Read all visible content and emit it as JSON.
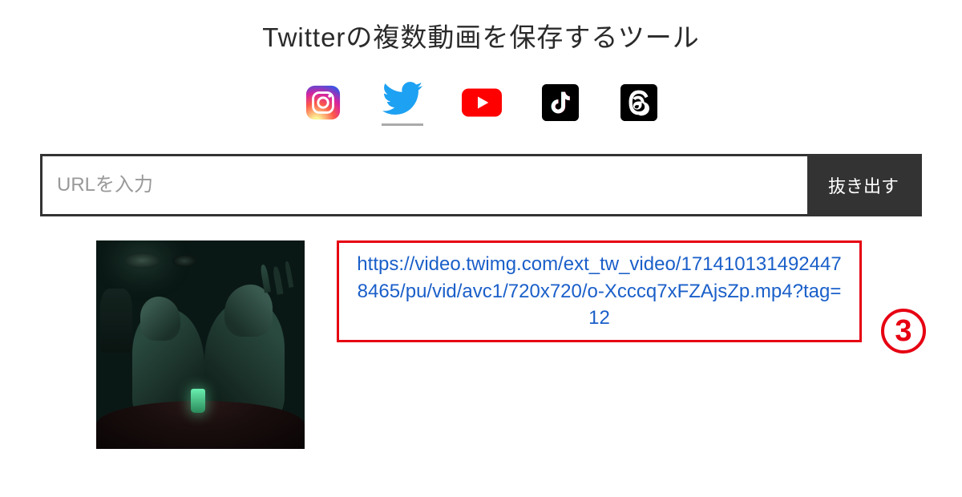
{
  "title": "Twitterの複数動画を保存するツール",
  "social": {
    "instagram": "Instagram",
    "twitter": "Twitter",
    "youtube": "YouTube",
    "tiktok": "TikTok",
    "threads": "Threads"
  },
  "input": {
    "placeholder": "URLを入力"
  },
  "button": {
    "extract": "抜き出す"
  },
  "result": {
    "url": "https://video.twimg.com/ext_tw_video/1714101314924478465/pu/vid/avc1/720x720/o-Xcccq7xFZAjsZp.mp4?tag=12"
  },
  "annotation": {
    "step": "3"
  }
}
